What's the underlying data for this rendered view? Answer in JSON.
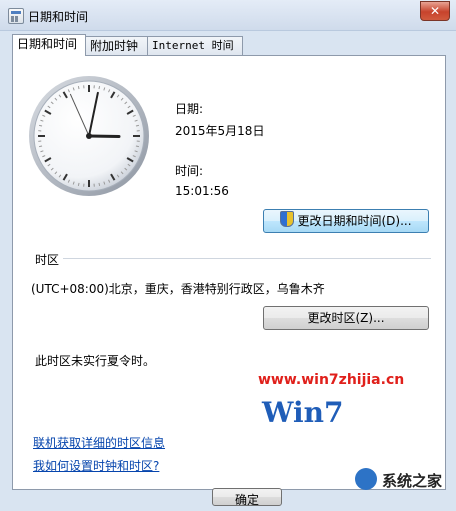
{
  "window": {
    "title": "日期和时间",
    "close_label": "✕"
  },
  "tabs": [
    {
      "label": "日期和时间",
      "active": true
    },
    {
      "label": "附加时钟",
      "active": false
    },
    {
      "label": "Internet 时间",
      "active": false
    }
  ],
  "datetime": {
    "date_label": "日期:",
    "date_value": "2015年5月18日",
    "time_label": "时间:",
    "time_value": "15:01:56",
    "change_button": "更改日期和时间(D)..."
  },
  "clock": {
    "hour": 15,
    "minute": 1,
    "second": 56
  },
  "timezone": {
    "section_label": "时区",
    "value": "(UTC+08:00)北京，重庆，香港特别行政区，乌鲁木齐",
    "change_button": "更改时区(Z)...",
    "dst_note": "此时区未实行夏令时。"
  },
  "links": {
    "online_info": "联机获取详细的时区信息",
    "how_to": "我如何设置时钟和时区?"
  },
  "footer": {
    "ok_button": "确定"
  },
  "watermark": {
    "text": "www.win7zhijia.cn",
    "logo_text": "Win7",
    "site_text": "系统之家"
  },
  "colors": {
    "link": "#0645ad",
    "title_bar": "#d9e4f1",
    "close_button": "#c7432c",
    "watermark": "#e0201b"
  }
}
